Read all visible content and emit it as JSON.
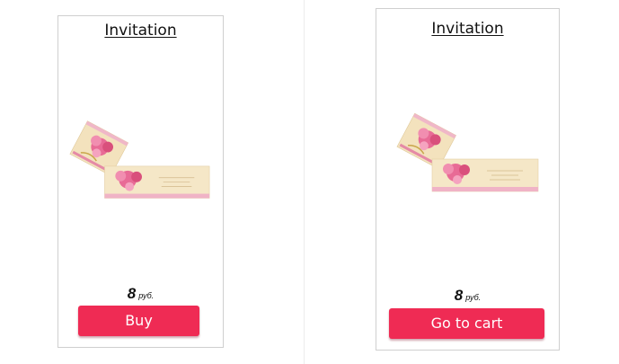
{
  "products": [
    {
      "title": "Invitation",
      "image_icon": "invitation-card-image",
      "price_value": "8",
      "price_currency": "руб.",
      "button_label": "Buy"
    },
    {
      "title": "Invitation",
      "image_icon": "invitation-card-image",
      "price_value": "8",
      "price_currency": "руб.",
      "button_label": "Go to cart"
    }
  ],
  "colors": {
    "button": "#ef2b54",
    "card_border": "#cfcfcf",
    "flower_pink": "#e86b96",
    "card_cream": "#f3e2bd"
  }
}
